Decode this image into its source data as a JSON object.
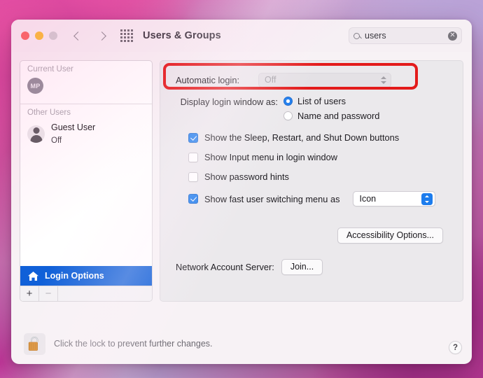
{
  "window": {
    "title": "Users & Groups",
    "traffic_lights": [
      "close-red",
      "minimize-yellow",
      "zoom-gray"
    ],
    "back_label": "‹",
    "forward_label": "›",
    "show_all_label": "show-all-grid"
  },
  "search": {
    "value": "users",
    "placeholder": "Search",
    "clear_label": "✕"
  },
  "sidebar": {
    "groups": [
      {
        "header": "Current User",
        "users": [
          {
            "initials": "MP",
            "name": "",
            "status": ""
          }
        ]
      },
      {
        "header": "Other Users",
        "users": [
          {
            "initials": "",
            "name": "Guest User",
            "status": "Off"
          }
        ]
      }
    ],
    "login_options": {
      "label": "Login Options",
      "selected": true,
      "selection_color": "#1060d8"
    },
    "footer": {
      "add_label": "+",
      "remove_label": "−"
    }
  },
  "main": {
    "automatic_login": {
      "label": "Automatic login:",
      "value": "Off",
      "enabled": false,
      "highlighted": true,
      "highlight_color": "#e31b1b"
    },
    "display_login_window": {
      "label": "Display login window as:",
      "options": [
        {
          "label": "List of users",
          "selected": true
        },
        {
          "label": "Name and password",
          "selected": false
        }
      ]
    },
    "checkboxes": [
      {
        "label": "Show the Sleep, Restart, and Shut Down buttons",
        "checked": true
      },
      {
        "label": "Show Input menu in login window",
        "checked": false
      },
      {
        "label": "Show password hints",
        "checked": false
      }
    ],
    "fast_user_switching": {
      "label": "Show fast user switching menu as",
      "checked": true,
      "value": "Icon"
    },
    "accessibility_button": "Accessibility Options...",
    "network_account_server": {
      "label": "Network Account Server:",
      "button": "Join..."
    }
  },
  "footer": {
    "lock_text": "Click the lock to prevent further changes.",
    "lock_state": "unlocked",
    "help_label": "?"
  },
  "colors": {
    "accent_blue": "#1c7ced",
    "selection_blue": "#1060d8",
    "annotation_red": "#e31b1b",
    "window_bg": "#f7f2f5",
    "panel_bg": "#ebe9ec"
  }
}
